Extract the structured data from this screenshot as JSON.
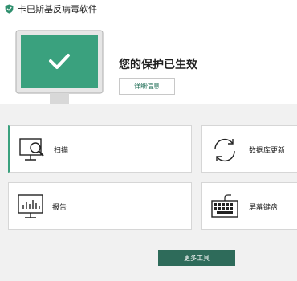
{
  "window": {
    "title": "卡巴斯基反病毒软件",
    "logo_icon": "kaspersky-shield-icon"
  },
  "status": {
    "title": "您的保护已生效",
    "details_button": "详细信息",
    "monitor_icon": "monitor-check-icon",
    "state_color": "#3aa17e"
  },
  "tiles": [
    {
      "label": "扫描",
      "icon": "scan-monitor-icon"
    },
    {
      "label": "数据库更新",
      "icon": "refresh-arrows-icon"
    },
    {
      "label": "报告",
      "icon": "report-chart-icon"
    },
    {
      "label": "屏幕键盘",
      "icon": "keyboard-icon"
    }
  ],
  "more_tools_button": "更多工具",
  "colors": {
    "accent": "#3aa17e",
    "button_dark": "#2e6b5a",
    "background_grey": "#f1f1f1"
  }
}
